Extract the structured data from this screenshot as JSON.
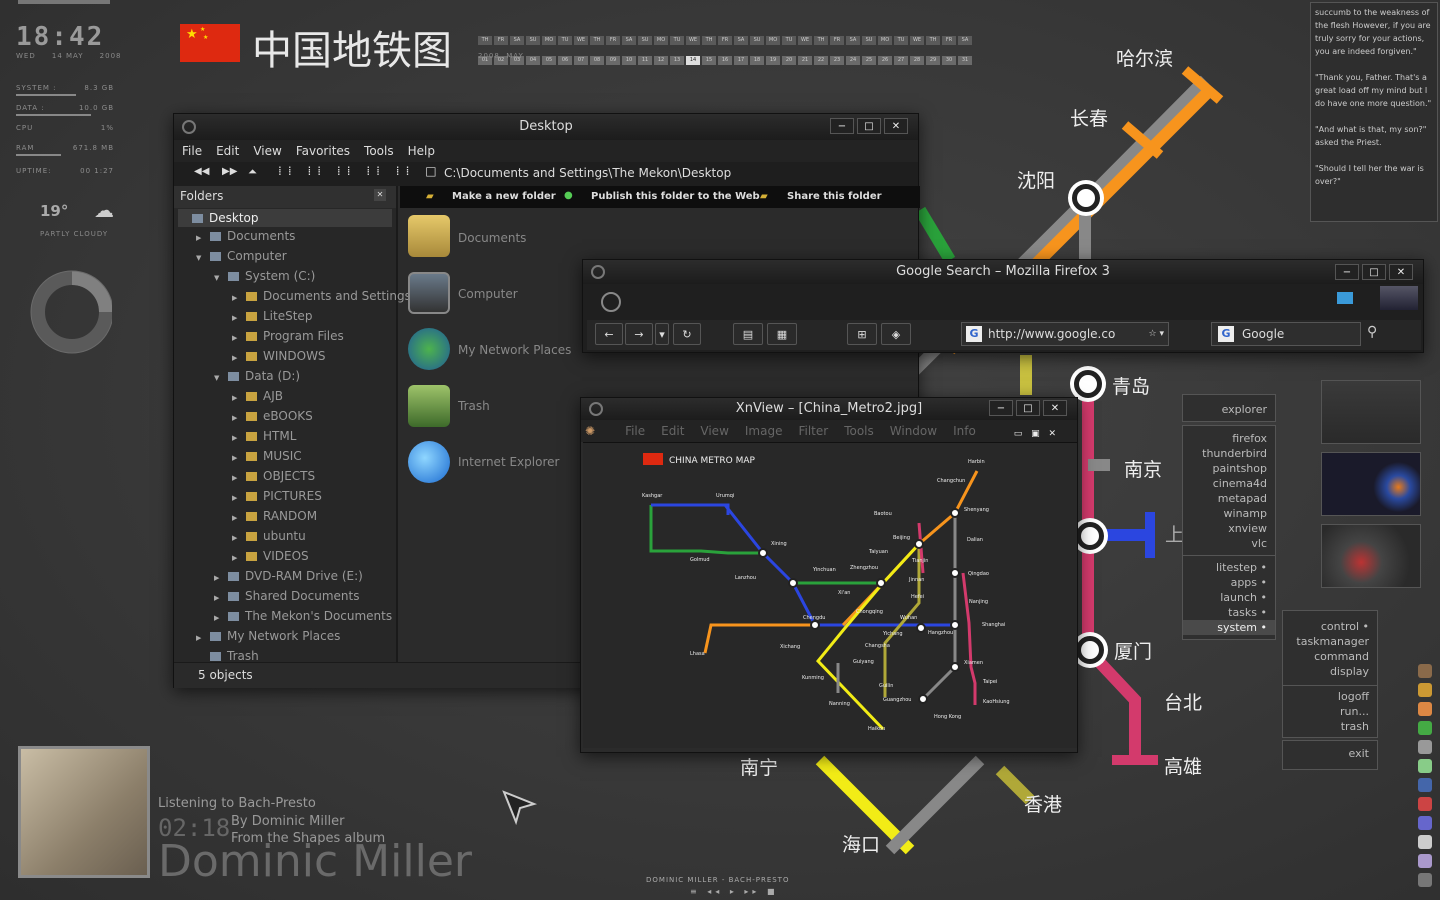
{
  "widgets": {
    "time": "18:42",
    "date": "WED     14 MAY     2008",
    "stats": [
      {
        "label": "SYSTEM :",
        "value": "8.3 GB"
      },
      {
        "label": "DATA :",
        "value": "10.0 GB"
      },
      {
        "label": "CPU",
        "value": "1%"
      },
      {
        "label": "RAM",
        "value": "671.8 MB"
      },
      {
        "label": "UPTIME:",
        "value": "00 1:27"
      }
    ],
    "temp": "19°",
    "condition": "PARTLY CLOUDY"
  },
  "header": {
    "title": "中国地铁图",
    "month": "2008  MAY",
    "days": [
      "TH",
      "FR",
      "SA",
      "SU",
      "MO",
      "TU",
      "WE",
      "TH",
      "FR",
      "SA",
      "SU",
      "MO",
      "TU",
      "WE",
      "TH",
      "FR",
      "SA",
      "SU",
      "MO",
      "TU",
      "WE",
      "TH",
      "FR",
      "SA",
      "SU",
      "MO",
      "TU",
      "WE",
      "TH",
      "FR",
      "SA"
    ],
    "dates": [
      "01",
      "02",
      "03",
      "04",
      "05",
      "06",
      "07",
      "08",
      "09",
      "10",
      "11",
      "12",
      "13",
      "14",
      "15",
      "16",
      "17",
      "18",
      "19",
      "20",
      "21",
      "22",
      "23",
      "24",
      "25",
      "26",
      "27",
      "28",
      "29",
      "30",
      "31"
    ]
  },
  "quote": "succumb to the weakness of the flesh However, if you are truly sorry for your actions, you are indeed forgiven.\"\n\n\"Thank you, Father. That's a great load off my mind but I do have one more question.\"\n\n\"And what is that, my son?\" asked the Priest.\n\n\"Should I tell her the war is over?\"",
  "map_cities": {
    "harbin": "哈尔滨",
    "changchun": "长春",
    "shenyang": "沈阳",
    "qingdao": "青岛",
    "nanjing": "南京",
    "shanghai": "上海",
    "xiamen": "厦门",
    "taibei": "台北",
    "gaoxiong": "高雄",
    "hongkong": "香港",
    "haikou": "海口",
    "nanning": "南宁"
  },
  "explorer": {
    "title": "Desktop",
    "menu": [
      "File",
      "Edit",
      "View",
      "Favorites",
      "Tools",
      "Help"
    ],
    "address": "C:\\Documents and Settings\\The Mekon\\Desktop",
    "folders_label": "Folders",
    "tasks": [
      "Make a new folder",
      "Publish this folder to the Web",
      "Share this folder"
    ],
    "tree": [
      {
        "label": "Desktop",
        "indent": 0,
        "arrow": ""
      },
      {
        "label": "Documents",
        "indent": 1,
        "arrow": "▶"
      },
      {
        "label": "Computer",
        "indent": 1,
        "arrow": "▼"
      },
      {
        "label": "System (C:)",
        "indent": 2,
        "arrow": "▼"
      },
      {
        "label": "Documents and Settings",
        "indent": 3,
        "arrow": "▶"
      },
      {
        "label": "LiteStep",
        "indent": 3,
        "arrow": "▶"
      },
      {
        "label": "Program Files",
        "indent": 3,
        "arrow": "▶"
      },
      {
        "label": "WINDOWS",
        "indent": 3,
        "arrow": "▶"
      },
      {
        "label": "Data (D:)",
        "indent": 2,
        "arrow": "▼"
      },
      {
        "label": "AJB",
        "indent": 3,
        "arrow": "▶"
      },
      {
        "label": "eBOOKS",
        "indent": 3,
        "arrow": "▶"
      },
      {
        "label": "HTML",
        "indent": 3,
        "arrow": "▶"
      },
      {
        "label": "MUSIC",
        "indent": 3,
        "arrow": "▶"
      },
      {
        "label": "OBJECTS",
        "indent": 3,
        "arrow": "▶"
      },
      {
        "label": "PICTURES",
        "indent": 3,
        "arrow": "▶"
      },
      {
        "label": "RANDOM",
        "indent": 3,
        "arrow": "▶"
      },
      {
        "label": "ubuntu",
        "indent": 3,
        "arrow": "▶"
      },
      {
        "label": "VIDEOS",
        "indent": 3,
        "arrow": "▶"
      },
      {
        "label": "DVD-RAM Drive (E:)",
        "indent": 2,
        "arrow": "▶"
      },
      {
        "label": "Shared Documents",
        "indent": 2,
        "arrow": "▶"
      },
      {
        "label": "The Mekon's Documents",
        "indent": 2,
        "arrow": "▶"
      },
      {
        "label": "My Network Places",
        "indent": 1,
        "arrow": "▶"
      },
      {
        "label": "Trash",
        "indent": 1,
        "arrow": ""
      }
    ],
    "items": [
      "Documents",
      "Computer",
      "My Network Places",
      "Trash",
      "Internet Explorer"
    ],
    "status": "5 objects"
  },
  "firefox": {
    "title": "Google Search – Mozilla Firefox 3",
    "url": "http://www.google.co",
    "search": "Google"
  },
  "xnview": {
    "title": "XnView – [China_Metro2.jpg]",
    "menu": [
      "File",
      "Edit",
      "View",
      "Image",
      "Filter",
      "Tools",
      "Window",
      "Info"
    ],
    "map_title": "CHINA METRO MAP",
    "cities": [
      "Harbin",
      "Changchun",
      "Shenyang",
      "Dalian",
      "Beijing",
      "Tianjin",
      "Baotou",
      "Taiyuan",
      "Qingdao",
      "Kashgar",
      "Urumqi",
      "Golmud",
      "Xining",
      "Lanzhou",
      "Yinchuan",
      "Zhengzhou",
      "Xi'an",
      "Jinnan",
      "Hefei",
      "Nanjing",
      "Chongqing",
      "Chengdu",
      "Wuhan",
      "Yichang",
      "Hangzhou",
      "Shanghai",
      "Changsha",
      "Xichang",
      "Lhasa",
      "Guiyang",
      "Kunming",
      "Guilin",
      "Xiamen",
      "Taipei",
      "KaoHsiung",
      "Nanning",
      "Guangzhou",
      "Hong Kong",
      "Haikou"
    ]
  },
  "launcher": {
    "top": "explorer",
    "apps": [
      "firefox",
      "thunderbird",
      "paintshop",
      "cinema4d",
      "metapad",
      "winamp",
      "xnview",
      "vlc"
    ],
    "groups": [
      "litestep •",
      "apps •",
      "launch •",
      "tasks •",
      "system •"
    ],
    "system": [
      "control •",
      "taskmanager",
      "command",
      "display"
    ],
    "session": [
      "logoff",
      "run...",
      "trash"
    ],
    "exit": "exit"
  },
  "nowplaying": {
    "listening": "Listening to Bach-Presto",
    "elapsed": "02:18",
    "by": "By Dominic Miller\nFrom the Shapes album",
    "artist": "Dominic Miller",
    "bar": "DOMINIC MILLER - BACH-PRESTO",
    "controls": "≡ ◂◂ ▸ ▸▸ ■"
  }
}
